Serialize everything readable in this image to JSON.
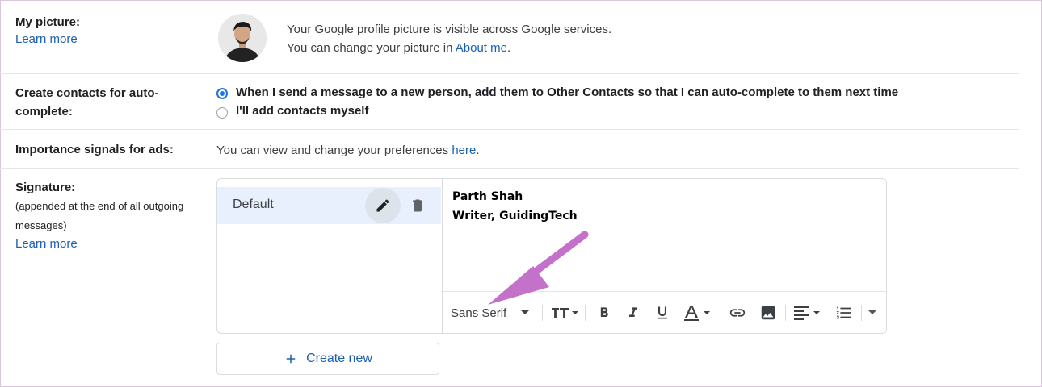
{
  "picture": {
    "label": "My picture:",
    "learn_more": "Learn more",
    "line1": "Your Google profile picture is visible across Google services.",
    "line2_prefix": "You can change your picture in ",
    "line2_link": "About me",
    "line2_suffix": "."
  },
  "contacts": {
    "label_line1": "Create contacts for auto-",
    "label_line2": "complete:",
    "option1": "When I send a message to a new person, add them to Other Contacts so that I can auto-complete to them next time",
    "option2": "I'll add contacts myself"
  },
  "ads": {
    "label": "Importance signals for ads:",
    "text_prefix": "You can view and change your preferences ",
    "text_link": "here",
    "text_suffix": "."
  },
  "signature": {
    "label": "Signature:",
    "sub1": "(appended at the end of all outgoing",
    "sub2": "messages)",
    "learn_more": "Learn more",
    "item": "Default",
    "body_line1": "Parth Shah",
    "body_line2": "Writer, GuidingTech",
    "font": "Sans Serif",
    "create_new": "Create new"
  },
  "colors": {
    "link": "#1a5fb4",
    "selected_item_bg": "#e8f0fe",
    "radio_accent": "#1a73e8",
    "annotation_arrow": "#c471c9"
  },
  "icons": [
    "edit-pencil-icon",
    "delete-trash-icon",
    "text-size-icon",
    "bold-icon",
    "italic-icon",
    "underline-icon",
    "text-color-icon",
    "link-icon",
    "image-icon",
    "align-icon",
    "numbered-list-icon",
    "more-options-icon",
    "plus-icon"
  ]
}
